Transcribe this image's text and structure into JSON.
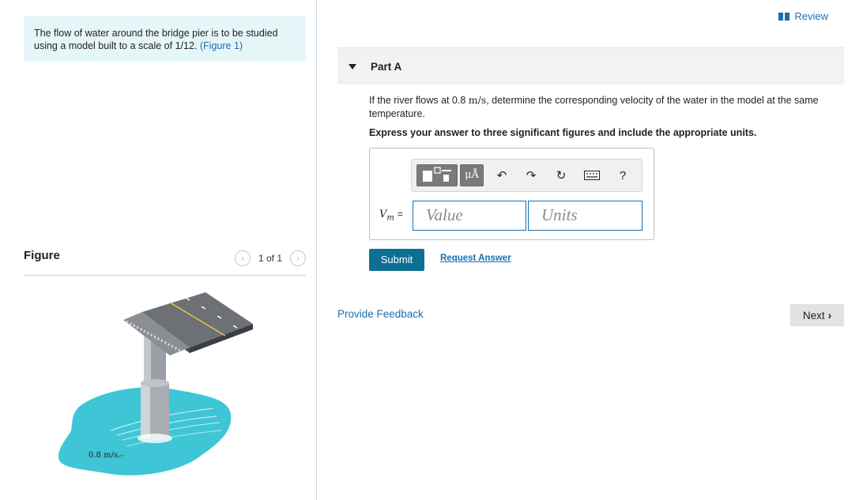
{
  "problem": {
    "text": "The flow of water around the bridge pier is to be studied using a model built to a scale of 1/12.",
    "figure_link": "(Figure 1)"
  },
  "figure_panel": {
    "title": "Figure",
    "page_count": "1 of 1",
    "prev_icon": "chevron-left-icon",
    "next_icon": "chevron-right-icon",
    "velocity_label": "0.8 m/s"
  },
  "header": {
    "review_label": "Review",
    "review_icon": "book-icon"
  },
  "part": {
    "label": "Part A",
    "question_pre": "If the river flows at 0.8 ",
    "question_unit": "m/s",
    "question_post": ", determine the corresponding velocity of the water in the model at the same temperature.",
    "instruction": "Express your answer to three significant figures and include the appropriate units."
  },
  "answer": {
    "toolbar": {
      "units_button": "μÅ",
      "icons": [
        "templates-icon",
        "units-icon",
        "undo-icon",
        "redo-icon",
        "reset-icon",
        "keyboard-icon",
        "help-icon"
      ],
      "help_label": "?"
    },
    "variable": "V",
    "variable_sub": "m",
    "equals": "=",
    "value_placeholder": "Value",
    "units_placeholder": "Units"
  },
  "actions": {
    "submit_label": "Submit",
    "request_answer_label": "Request Answer",
    "feedback_label": "Provide Feedback",
    "next_label": "Next"
  },
  "colors": {
    "accent_blue": "#1a6fb0",
    "submit_bg": "#0e6f93",
    "problem_bg": "#e6f6f8",
    "water": "#3ec6d6"
  }
}
